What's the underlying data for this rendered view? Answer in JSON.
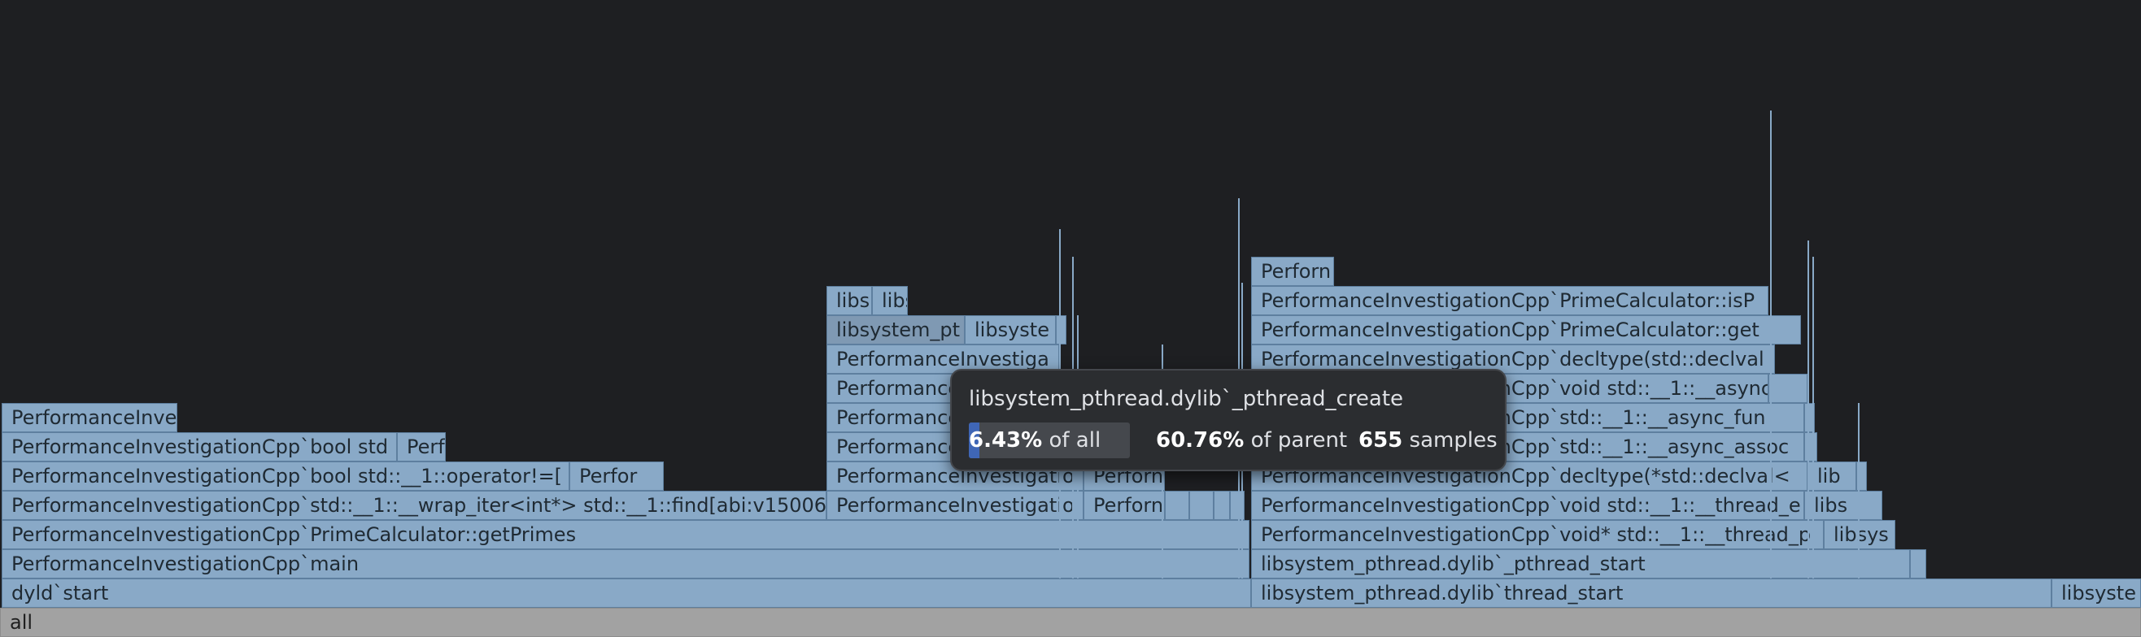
{
  "root_label": "all",
  "frames_text": [
    {
      "label": "dyld`start"
    },
    {
      "label": "libsystem_pthread.dylib`thread_start"
    },
    {
      "label": "libsyste"
    },
    {
      "label": "PerformanceInvestigationCpp`main"
    },
    {
      "label": "libsystem_pthread.dylib`_pthread_start"
    },
    {
      "label": "PerformanceInvestigationCpp`PrimeCalculator::getPrimes"
    },
    {
      "label": "PerformanceInvestigationCpp`void* std::__1::__thread_p"
    },
    {
      "label": "libsys"
    },
    {
      "label": "PerformanceInvestigationCpp`std::__1::__wrap_iter<int*> std::__1::find[abi:v15006"
    },
    {
      "label": "PerformanceInvestigatio"
    },
    {
      "label": "Perforn"
    },
    {
      "label": "PerformanceInvestigationCpp`void std::__1::__thread_e"
    },
    {
      "label": "libs"
    },
    {
      "label": "PerformanceInvestigationCpp`bool std::__1::operator!=["
    },
    {
      "label": "Perfor"
    },
    {
      "label": "PerformanceInvestigatio"
    },
    {
      "label": "Perforn"
    },
    {
      "label": "PerformanceInvestigationCpp`decltype(*std::declval<"
    },
    {
      "label": "lib"
    },
    {
      "label": "PerformanceInvestigationCpp`bool std"
    },
    {
      "label": "Perf"
    },
    {
      "label": "PerformanceInvestiga"
    },
    {
      "label": "PerformanceInvestigationCpp`std::__1::__async_assoc"
    },
    {
      "label": "PerformanceInve"
    },
    {
      "label": "PerformanceInvestiga"
    },
    {
      "label": "PerformanceInvestigationCpp`std::__1::__async_fun"
    },
    {
      "label": "PerformanceInvestiga"
    },
    {
      "label": "PerformanceInvestigationCpp`void std::__1::__async"
    },
    {
      "label": "PerformanceInvestiga"
    },
    {
      "label": "PerformanceInvestigationCpp`decltype(std::declval"
    },
    {
      "label": "libsystem_pt"
    },
    {
      "label": "libsyste"
    },
    {
      "label": "PerformanceInvestigationCpp`PrimeCalculator::get"
    },
    {
      "label": "libs"
    },
    {
      "label": "libs"
    },
    {
      "label": "PerformanceInvestigationCpp`PrimeCalculator::isP"
    },
    {
      "label": "Perforn"
    }
  ],
  "tooltip": {
    "title": "libsystem_pthread.dylib`_pthread_create",
    "percent_all": "6.43%",
    "percent_all_value": 6.43,
    "of_all": "of all",
    "percent_parent": "60.76%",
    "of_parent": "of parent",
    "samples": "655",
    "samples_label": "samples"
  },
  "colors": {
    "background": "#1e1f22",
    "frame": "#89a9c7",
    "root": "#a2a2a2",
    "tooltip_bg": "#2b2d30",
    "bar_fill": "#3f66b6"
  }
}
